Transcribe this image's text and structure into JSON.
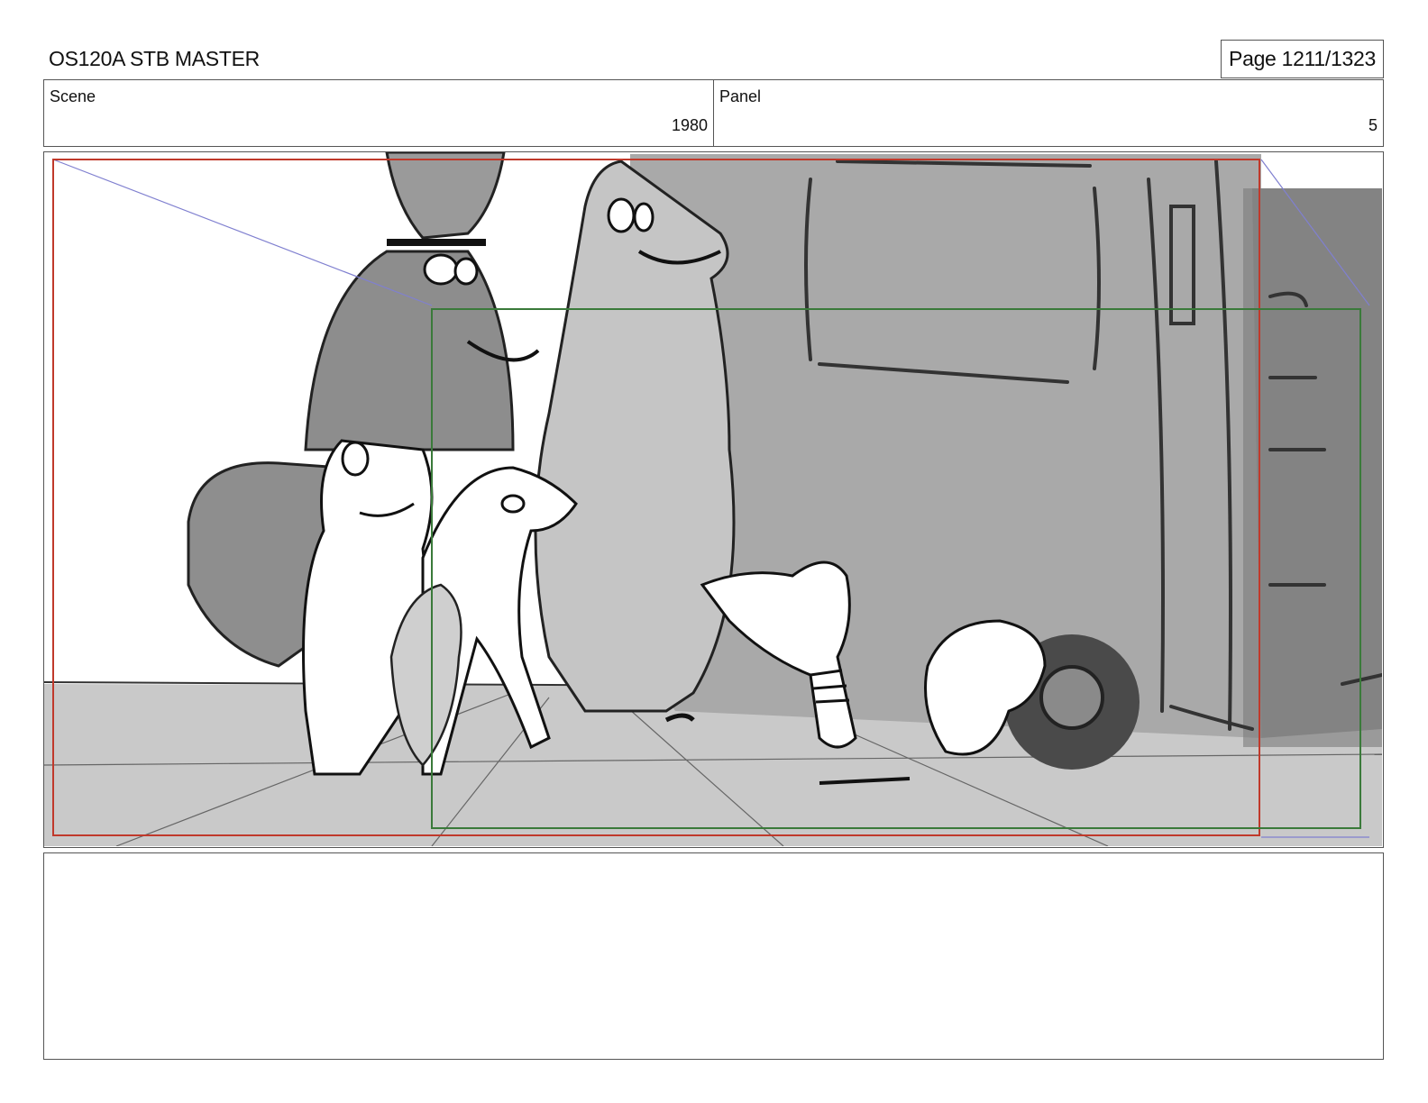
{
  "document": {
    "title": "OS120A STB MASTER",
    "page_label": "Page 1211/1323"
  },
  "info": {
    "scene_label": "Scene",
    "scene_value": "1980",
    "panel_label": "Panel",
    "panel_value": "5"
  },
  "frame": {
    "image_description_icon": "storyboard-sketch-icon",
    "guide_colors": {
      "action_safe": "#c0392b",
      "camera_field": "#3a7a3a",
      "motion_guide": "#8080d0"
    }
  },
  "notes": {
    "text": ""
  }
}
